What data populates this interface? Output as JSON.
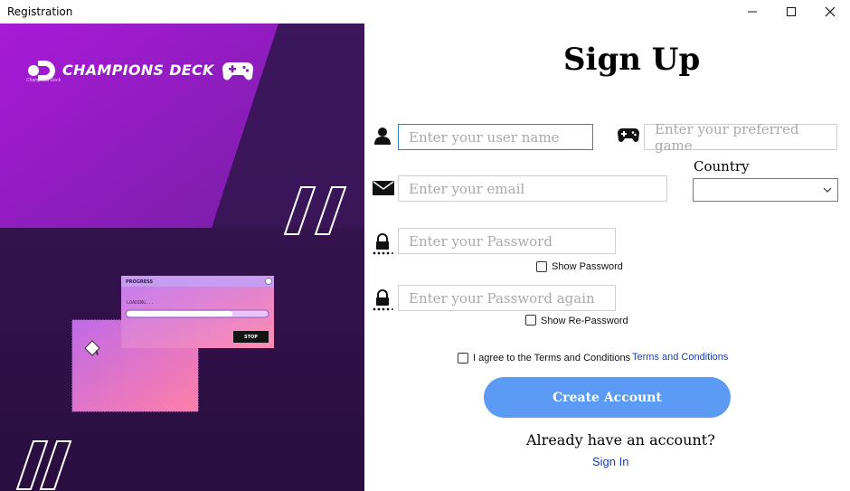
{
  "window": {
    "title": "Registration"
  },
  "brand": {
    "name": "CHAMPIONS DECK",
    "tagline": "Champions Deck"
  },
  "illustration": {
    "progress_title": "PROGRESS",
    "loading_text": "LOADING...",
    "progress_fraction": 0.75,
    "stop_label": "STOP"
  },
  "form": {
    "title": "Sign Up",
    "username": {
      "placeholder": "Enter your user name"
    },
    "game": {
      "placeholder": "Enter your preferred game"
    },
    "email": {
      "placeholder": "Enter your email"
    },
    "country": {
      "label": "Country",
      "selected": ""
    },
    "password": {
      "placeholder": "Enter your Password",
      "show_label": "Show Password"
    },
    "repassword": {
      "placeholder": "Enter your Password again",
      "show_label": "Show Re-Password"
    },
    "terms": {
      "agree_label": "I agree to the Terms and Conditions",
      "link_label": "Terms and Conditions"
    },
    "submit_label": "Create Account",
    "already_text": "Already have an account?",
    "signin_label": "Sign In"
  },
  "colors": {
    "accent": "#5b9bf5",
    "link": "#1c3faa",
    "left_bg": "#3a1454",
    "left_magenta": "#a21ad6"
  }
}
